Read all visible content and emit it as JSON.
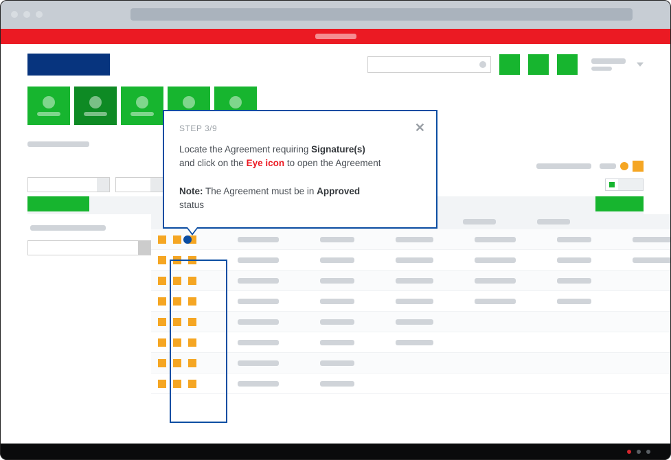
{
  "tooltip": {
    "step_label": "STEP 3/9",
    "line1_a": "Locate the Agreement requiring ",
    "line1_b": "Signature(s)",
    "line2_a": "and click on the ",
    "line2_red": "Eye icon",
    "line2_b": " to open the Agreement",
    "note_label": "Note:",
    "note_a": " The Agreement must be in ",
    "note_b": "Approved",
    "note_c": " status"
  }
}
